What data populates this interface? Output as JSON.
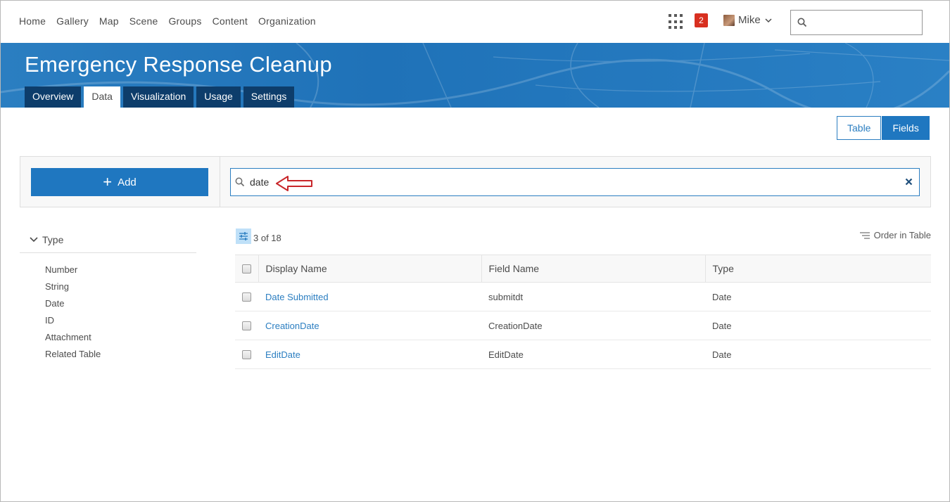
{
  "nav": {
    "links": [
      "Home",
      "Gallery",
      "Map",
      "Scene",
      "Groups",
      "Content",
      "Organization"
    ],
    "notification_count": "2",
    "user_name": "Mike",
    "search_placeholder": ""
  },
  "header": {
    "title": "Emergency Response Cleanup",
    "tabs": [
      {
        "label": "Overview",
        "active": false
      },
      {
        "label": "Data",
        "active": true
      },
      {
        "label": "Visualization",
        "active": false
      },
      {
        "label": "Usage",
        "active": false
      },
      {
        "label": "Settings",
        "active": false
      }
    ]
  },
  "view_toggle": {
    "table_label": "Table",
    "fields_label": "Fields",
    "active": "Fields"
  },
  "toolbar": {
    "add_label": "Add",
    "search_value": "date"
  },
  "filter": {
    "heading": "Type",
    "items": [
      "Number",
      "String",
      "Date",
      "ID",
      "Attachment",
      "Related Table"
    ]
  },
  "results": {
    "count_text": "3 of 18",
    "order_label": "Order in Table",
    "columns": [
      "Display Name",
      "Field Name",
      "Type"
    ],
    "rows": [
      {
        "display_name": "Date Submitted",
        "field_name": "submitdt",
        "type": "Date"
      },
      {
        "display_name": "CreationDate",
        "field_name": "CreationDate",
        "type": "Date"
      },
      {
        "display_name": "EditDate",
        "field_name": "EditDate",
        "type": "Date"
      }
    ]
  },
  "colors": {
    "accent": "#1f77c0",
    "banner": "#2b7ec1",
    "tab_dark": "#0d3d6b",
    "badge": "#d83020",
    "annotation_arrow": "#c8262a"
  }
}
